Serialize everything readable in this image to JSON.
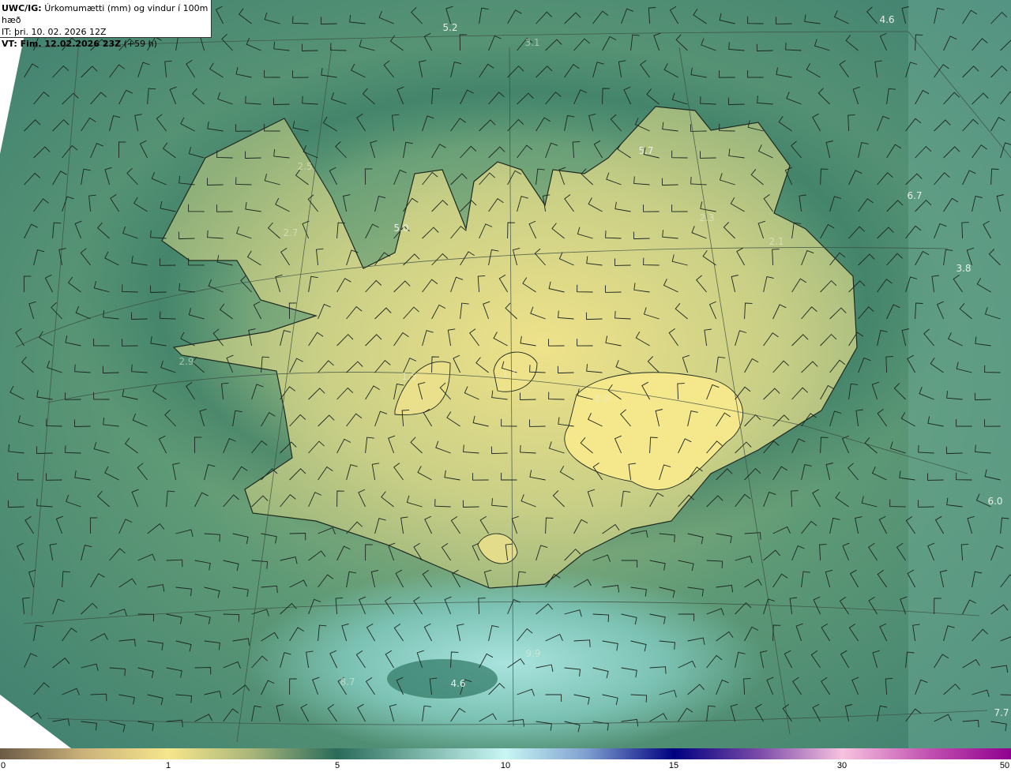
{
  "header": {
    "model_label": "UWC/IG:",
    "title": "Úrkomumætti (mm) og vindur í 100m hæð",
    "init_time": "IT: þri. 10. 02. 2026 12Z",
    "valid_label": "VT: Fim. 12.02.2026 23Z",
    "lead_time": "(+59 h)"
  },
  "colorbar": {
    "ticks": [
      "0",
      "1",
      "5",
      "10",
      "15",
      "30",
      "50"
    ],
    "colors": [
      "#6b5a45",
      "#f6e68c",
      "#2a6b5a",
      "#c8f6f4",
      "#000080",
      "#f8c2e0",
      "#900090"
    ]
  },
  "map_values": [
    {
      "text": "5.2",
      "faint": false
    },
    {
      "text": "3.1",
      "faint": true
    },
    {
      "text": "4.6",
      "faint": false
    },
    {
      "text": "5.7",
      "faint": false
    },
    {
      "text": "6.7",
      "faint": false
    },
    {
      "text": "2.5",
      "faint": true
    },
    {
      "text": "2.7",
      "faint": true
    },
    {
      "text": "5.0",
      "faint": false
    },
    {
      "text": "2.3",
      "faint": true
    },
    {
      "text": "2.1",
      "faint": true
    },
    {
      "text": "3.8",
      "faint": false
    },
    {
      "text": "2.9",
      "faint": true
    },
    {
      "text": "1.5",
      "faint": true
    },
    {
      "text": "1.1",
      "faint": true
    },
    {
      "text": "1.0",
      "faint": true
    },
    {
      "text": "6.0",
      "faint": false
    },
    {
      "text": "9.9",
      "faint": true
    },
    {
      "text": "4.6",
      "faint": false
    },
    {
      "text": "8.7",
      "faint": true
    },
    {
      "text": "7.7",
      "faint": false
    }
  ]
}
